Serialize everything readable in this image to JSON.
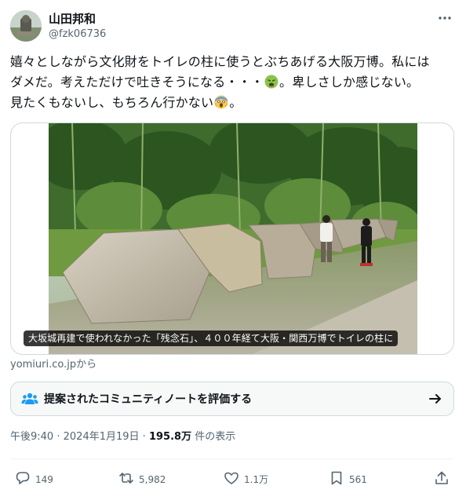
{
  "author": {
    "display_name": "山田邦和",
    "handle": "@fzk06736"
  },
  "tweet": {
    "line1": "嬉々としながら文化財をトイレの柱に使うとぶちあげる大阪万博。私には",
    "line2_a": "ダメだ。考えただけで吐きそうになる・・・",
    "line2_b": "。卑しさしか感じない。",
    "line3_a": "見たくもないし、もちろん行かない",
    "line3_b": "。"
  },
  "media": {
    "caption": "大坂城再建で使われなかった「残念石」、４００年経て大阪・関西万博でトイレの柱に",
    "source": "yomiuri.co.jpから"
  },
  "community_note": {
    "label": "提案されたコミュニティノートを評価する"
  },
  "meta": {
    "time": "午後9:40",
    "date": "2024年1月19日",
    "separator": "·",
    "views": "195.8万",
    "views_suffix": "件の表示"
  },
  "actions": {
    "replies": "149",
    "reposts": "5,982",
    "likes": "1.1万",
    "bookmarks": "561"
  },
  "icons": {
    "more": "more-options-icon",
    "nauseated": "nauseated-face-emoji",
    "scream": "screaming-face-emoji",
    "community": "community-people-icon",
    "arrow": "arrow-right-icon",
    "reply": "reply-icon",
    "repost": "repost-icon",
    "like": "heart-icon",
    "bookmark": "bookmark-icon",
    "share": "share-icon"
  },
  "colors": {
    "text": "#0f1419",
    "secondary": "#536471",
    "border": "#cfd9de"
  }
}
